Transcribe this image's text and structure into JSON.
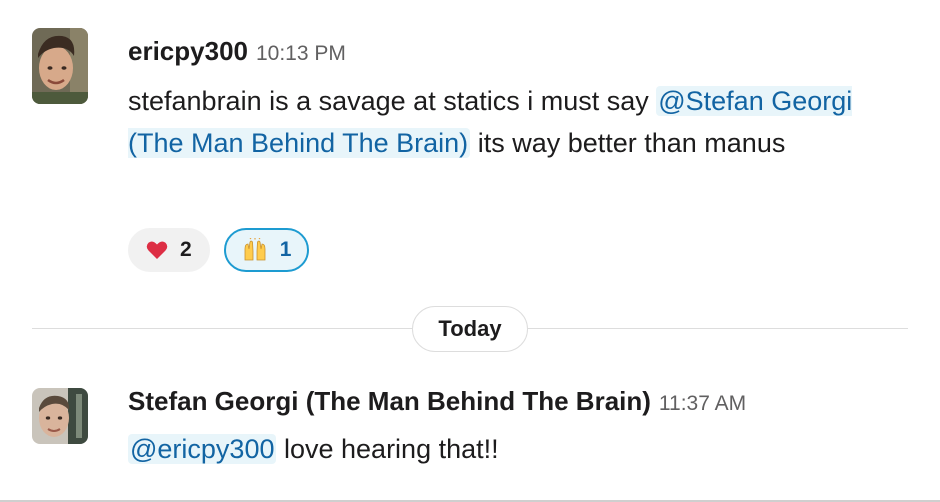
{
  "messages": [
    {
      "author": "ericpy300",
      "time": "10:13 PM",
      "text_part1": "stefanbrain is a savage at statics i must say ",
      "mention": "@Stefan Georgi (The Man Behind The Brain)",
      "text_part2": " its way better than manus",
      "reactions": [
        {
          "emoji": "heart-emoji",
          "count": "2",
          "active": false
        },
        {
          "emoji": "raised-hands-emoji",
          "count": "1",
          "active": true
        }
      ]
    },
    {
      "author": "Stefan Georgi (The Man Behind The Brain)",
      "time": "11:37 AM",
      "mention": "@ericpy300",
      "text": " love hearing that!!"
    }
  ],
  "day_divider": "Today",
  "colors": {
    "mention_bg": "#e8f5fa",
    "mention_text": "#1264a3",
    "active_reaction_border": "#1d9bd1"
  }
}
